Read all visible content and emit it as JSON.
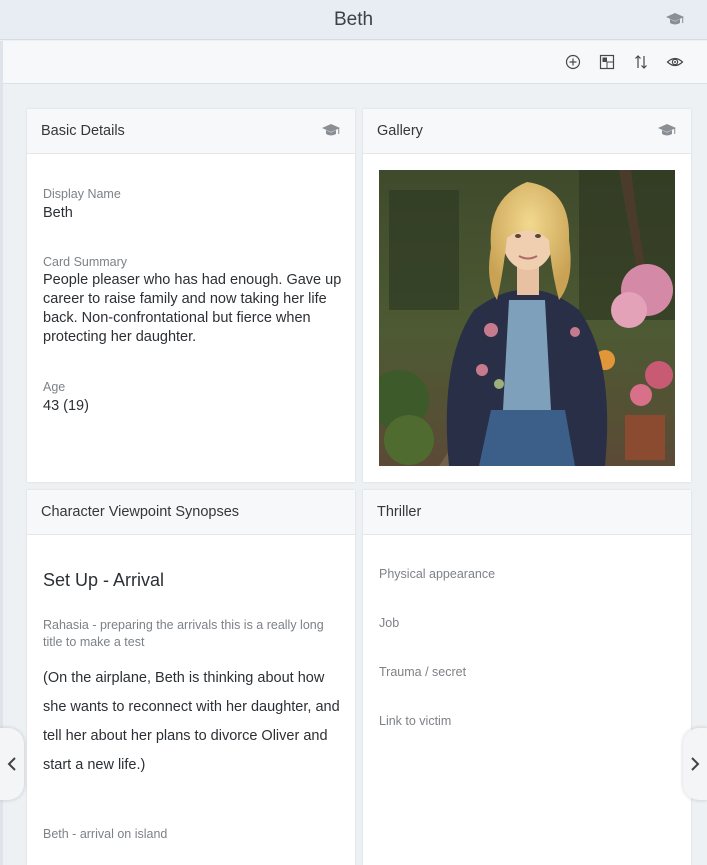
{
  "window": {
    "title": "Beth"
  },
  "toolbar": {
    "buttons": [
      {
        "icon": "add-circle-icon"
      },
      {
        "icon": "layout-icon"
      },
      {
        "icon": "sort-icon"
      },
      {
        "icon": "eye-icon"
      }
    ]
  },
  "basic_details": {
    "header": "Basic Details",
    "display_name_label": "Display Name",
    "display_name_value": "Beth",
    "summary_label": "Card Summary",
    "summary_value": "People pleaser who has had enough. Gave up career to raise family and now taking her life back. Non-confrontational but fierce when protecting her daughter.",
    "age_label": "Age",
    "age_value": "43 (19)"
  },
  "gallery": {
    "header": "Gallery"
  },
  "synopses": {
    "header": "Character Viewpoint Synopses",
    "title": "Set Up - Arrival",
    "subtitle": "Rahasia - preparing the arrivals this is a really long title to make a test",
    "body": "(On the airplane, Beth is thinking about how she wants to reconnect with her daughter, and tell her about her plans to divorce Oliver and start a new life.)",
    "next_item": "Beth - arrival on island"
  },
  "thriller": {
    "header": "Thriller",
    "fields": [
      "Physical appearance",
      "Job",
      "Trauma / secret",
      "Link to victim"
    ]
  },
  "colors": {
    "titlebar_bg": "#e8edf3",
    "card_header_bg": "#f7f8f9",
    "page_bg": "#eef1f4"
  }
}
